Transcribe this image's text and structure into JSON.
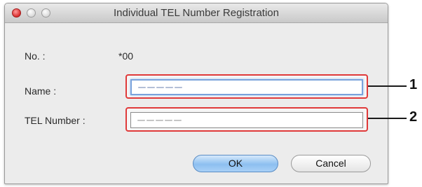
{
  "window": {
    "title": "Individual TEL Number Registration"
  },
  "form": {
    "no_label": "No. :",
    "no_value": "*00",
    "name_label": "Name :",
    "name_value": "ーーーーー",
    "tel_label": "TEL Number :",
    "tel_value": "ーーーーー"
  },
  "callouts": {
    "name": "1",
    "tel": "2"
  },
  "buttons": {
    "ok": "OK",
    "cancel": "Cancel"
  }
}
